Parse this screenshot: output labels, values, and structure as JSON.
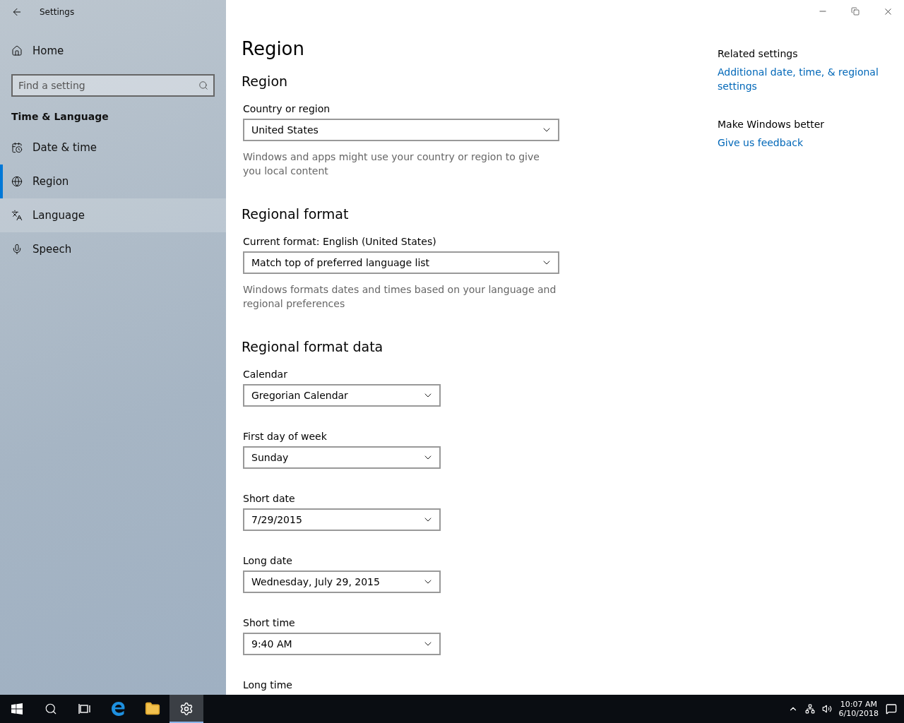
{
  "window": {
    "title": "Settings"
  },
  "sidebar": {
    "home": "Home",
    "search": {
      "placeholder": "Find a setting"
    },
    "group": "Time & Language",
    "items": [
      {
        "kind": "calendar",
        "label": "Date & time",
        "selected": false,
        "highlighted": false
      },
      {
        "kind": "globe",
        "label": "Region",
        "selected": true,
        "highlighted": false
      },
      {
        "kind": "language",
        "label": "Language",
        "selected": false,
        "highlighted": true
      },
      {
        "kind": "mic",
        "label": "Speech",
        "selected": false,
        "highlighted": false
      }
    ]
  },
  "page": {
    "title": "Region",
    "sections": [
      {
        "heading": "Region",
        "fields": [
          {
            "label": "Country or region",
            "value": "United States",
            "kind": "wide",
            "description": "Windows and apps might use your country or region to give you local content"
          }
        ]
      },
      {
        "heading": "Regional format",
        "fields": [
          {
            "label": "Current format: English (United States)",
            "value": "Match top of preferred language list",
            "kind": "wide",
            "description": "Windows formats dates and times based on your language and regional preferences"
          }
        ]
      },
      {
        "heading": "Regional format data",
        "fields": [
          {
            "label": "Calendar",
            "value": "Gregorian Calendar",
            "kind": "narrow"
          },
          {
            "label": "First day of week",
            "value": "Sunday",
            "kind": "narrow"
          },
          {
            "label": "Short date",
            "value": "7/29/2015",
            "kind": "narrow"
          },
          {
            "label": "Long date",
            "value": "Wednesday, July 29, 2015",
            "kind": "narrow"
          },
          {
            "label": "Short time",
            "value": "9:40 AM",
            "kind": "narrow"
          },
          {
            "label": "Long time",
            "kind": "narrow"
          }
        ]
      }
    ]
  },
  "related": [
    {
      "heading": "Related settings",
      "link": "Additional date, time, & regional settings"
    },
    {
      "heading": "Make Windows better",
      "link": "Give us feedback"
    }
  ],
  "taskbar": {
    "apps": [
      {
        "kind": "start",
        "selected": false
      },
      {
        "kind": "search",
        "selected": false
      },
      {
        "kind": "taskview",
        "selected": false
      },
      {
        "kind": "edge",
        "selected": false
      },
      {
        "kind": "explorer",
        "selected": false
      },
      {
        "kind": "settings",
        "selected": true
      }
    ],
    "time": "10:07 AM",
    "date": "6/10/2018"
  }
}
